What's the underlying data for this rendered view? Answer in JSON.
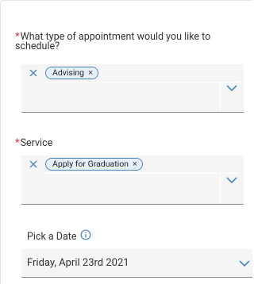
{
  "form": {
    "appointment_type": {
      "required_marker": "*",
      "label": "What type of appointment would you like to schedule?",
      "selected_chip": "Advising",
      "chip_remove_glyph": "×",
      "clear_icon": "close-icon",
      "dropdown_icon": "chevron-down-icon"
    },
    "service": {
      "required_marker": "*",
      "label": "Service",
      "selected_chip": "Apply for Graduation",
      "chip_remove_glyph": "×",
      "clear_icon": "close-icon",
      "dropdown_icon": "chevron-down-icon"
    },
    "date": {
      "label": "Pick a Date",
      "info_icon": "info-icon",
      "value": "Friday, April 23rd 2021",
      "dropdown_icon": "chevron-down-icon"
    }
  },
  "colors": {
    "required": "#d7263d",
    "accent": "#4a86c5",
    "chip_bg": "#e6f0fa",
    "field_bg": "#f5f5f5"
  }
}
